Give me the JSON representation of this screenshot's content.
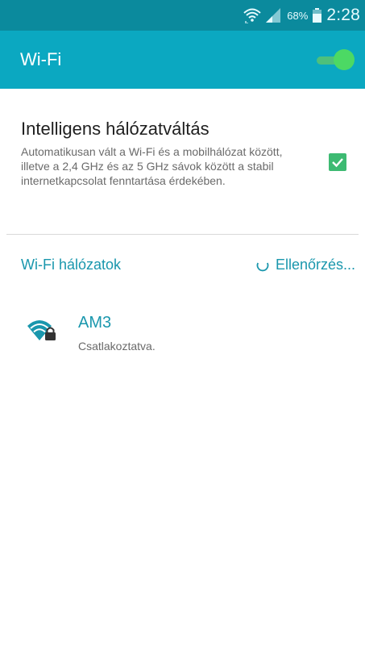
{
  "status_bar": {
    "wifi_icon": "wifi-signal-icon",
    "signal_icon": "cell-signal-icon",
    "battery_percent": "68%",
    "battery_icon": "battery-icon",
    "time": "2:28"
  },
  "app_bar": {
    "title": "Wi-Fi",
    "toggle_on": true,
    "colors": {
      "status_bar": "#0b8a9d",
      "app_bar": "#0ba8c1",
      "toggle": "#4cd964"
    }
  },
  "smart_network_switch": {
    "title": "Intelligens hálózatváltás",
    "description": "Automatikusan vált a Wi-Fi és a mobilhálózat között, illetve a 2,4 GHz és az 5 GHz sávok között a stabil internetkapcsolat fenntartása érdekében.",
    "checked": true,
    "check_color": "#3dba72"
  },
  "networks_section": {
    "title": "Wi-Fi hálózatok",
    "scan_label": "Ellenőrzés...",
    "accent_color": "#1a97ad"
  },
  "networks": [
    {
      "name": "AM3",
      "status": "Csatlakoztatva.",
      "icon": "wifi-locked-icon"
    }
  ]
}
